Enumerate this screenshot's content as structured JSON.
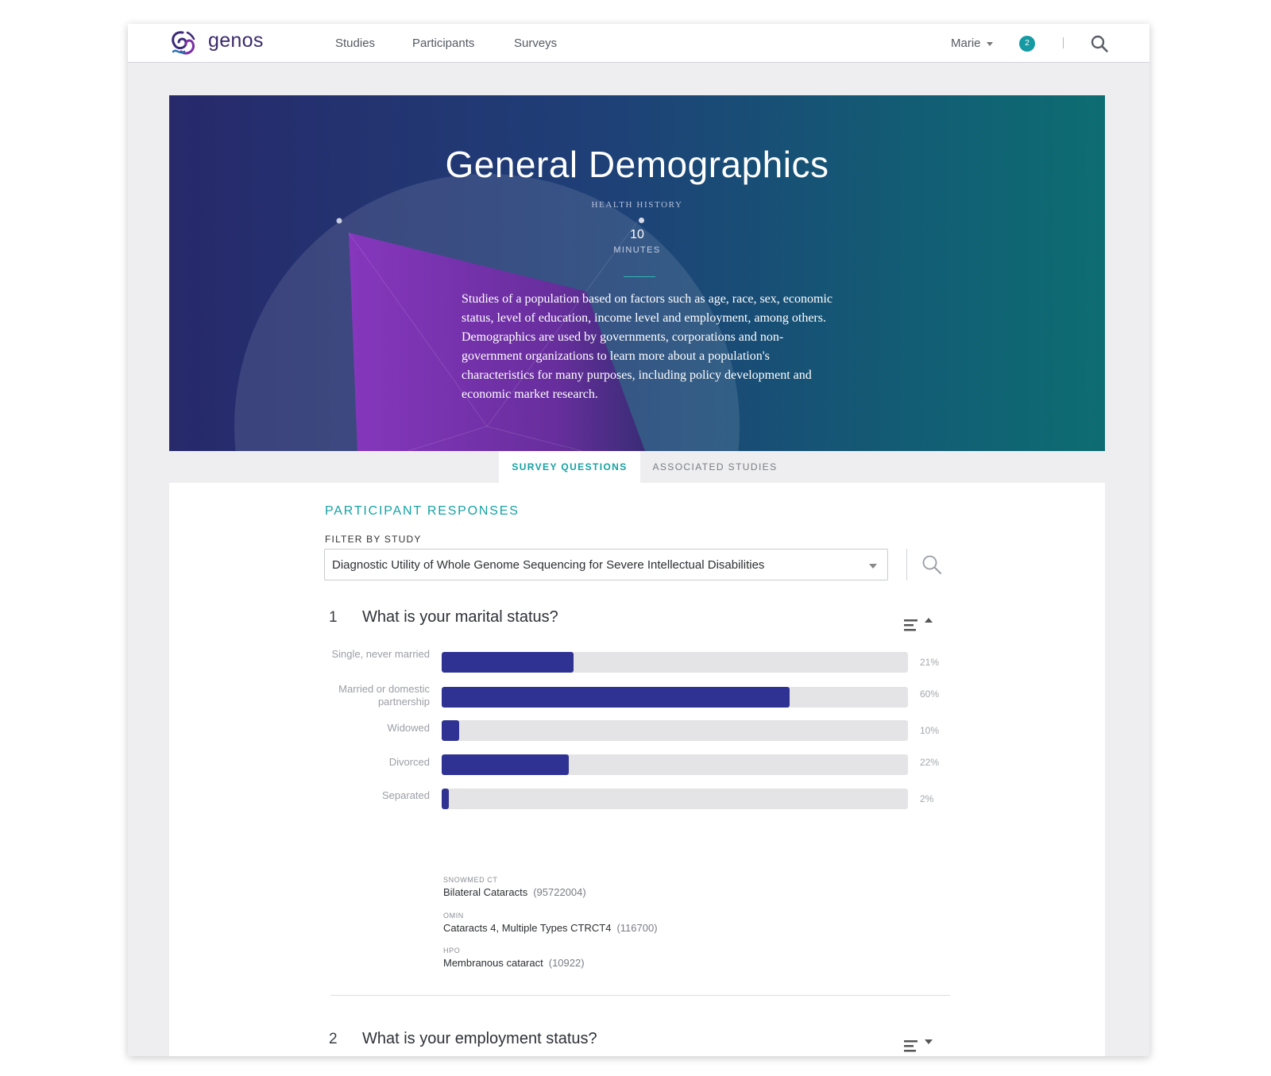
{
  "nav": {
    "brand": "genos",
    "links": [
      "Studies",
      "Participants",
      "Surveys"
    ],
    "user": "Marie",
    "notifications": "2"
  },
  "hero": {
    "title": "General Demographics",
    "category": "HEALTH HISTORY",
    "duration_value": "10",
    "duration_unit": "MINUTES",
    "description": "Studies of a population based on factors such as age, race, sex, economic status, level of education, income level and employment, among others. Demographics are used by governments, corporations and non-government organizations to learn more about a population's characteristics for many purposes, including policy development and economic market research."
  },
  "tabs": [
    {
      "label": "SURVEY QUESTIONS",
      "active": true
    },
    {
      "label": "ASSOCIATED STUDIES",
      "active": false
    }
  ],
  "responses": {
    "title": "PARTICIPANT RESPONSES",
    "filter_label": "FILTER BY STUDY",
    "filter_value": "Diagnostic Utility of Whole Genome Sequencing for Severe Intellectual Disabilities"
  },
  "questions": [
    {
      "number": "1",
      "text": "What is your marital status?",
      "expanded": true,
      "answers": [
        {
          "label": "Single, never married",
          "percent_text": "21%",
          "fill": 0.283
        },
        {
          "label": "Married or domestic partnership",
          "percent_text": "60%",
          "fill": 0.746
        },
        {
          "label": "Widowed",
          "percent_text": "10%",
          "fill": 0.038
        },
        {
          "label": "Divorced",
          "percent_text": "22%",
          "fill": 0.272
        },
        {
          "label": "Separated",
          "percent_text": "2%",
          "fill": 0.015
        }
      ],
      "codes": [
        {
          "source": "SNOWMED CT",
          "name": "Bilateral Cataracts",
          "id": "(95722004)"
        },
        {
          "source": "OMIN",
          "name": "Cataracts 4, Multiple Types CTRCT4",
          "id": "(116700)"
        },
        {
          "source": "HPO",
          "name": "Membranous cataract",
          "id": "(10922)"
        }
      ]
    },
    {
      "number": "2",
      "text": "What is your employment status?",
      "expanded": false
    }
  ],
  "colors": {
    "accent": "#15a1a3",
    "bar_fill": "#2f3293",
    "bar_track": "#e4e4e6",
    "hero_start": "#27296b",
    "hero_end": "#0d6d72",
    "highlight": "#7a2fa8"
  }
}
